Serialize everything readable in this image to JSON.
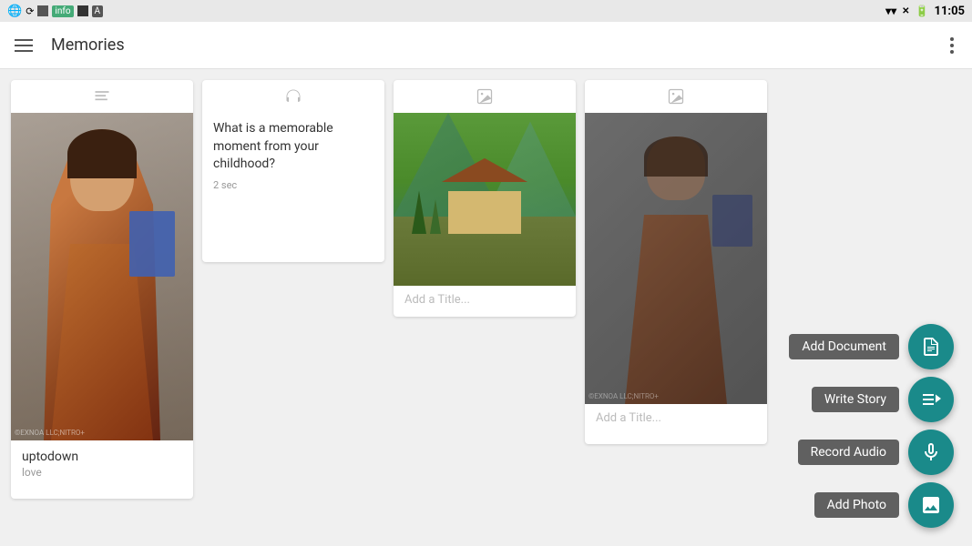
{
  "statusBar": {
    "time": "11:05",
    "icons": [
      "wifi",
      "signal",
      "battery"
    ]
  },
  "topBar": {
    "title": "Memories"
  },
  "cards": [
    {
      "id": "card1",
      "type": "image",
      "typeIcon": "image",
      "name": "uptodown",
      "subtitle": "love",
      "hasImage": true
    },
    {
      "id": "card2",
      "type": "audio",
      "typeIcon": "headphones",
      "question": "What is a memorable moment from your childhood?",
      "duration": "2 sec",
      "hasImage": false
    },
    {
      "id": "card3",
      "type": "image",
      "typeIcon": "image",
      "titlePlaceholder": "Add a Title...",
      "hasImage": true
    },
    {
      "id": "card4",
      "type": "image",
      "typeIcon": "image",
      "titlePlaceholder": "Add a Title...",
      "hasImage": true
    }
  ],
  "fabButtons": [
    {
      "id": "fab-document",
      "label": "Add Document",
      "icon": "document"
    },
    {
      "id": "fab-story",
      "label": "Write Story",
      "icon": "write"
    },
    {
      "id": "fab-audio",
      "label": "Record Audio",
      "icon": "microphone"
    },
    {
      "id": "fab-photo",
      "label": "Add Photo",
      "icon": "photo"
    }
  ]
}
